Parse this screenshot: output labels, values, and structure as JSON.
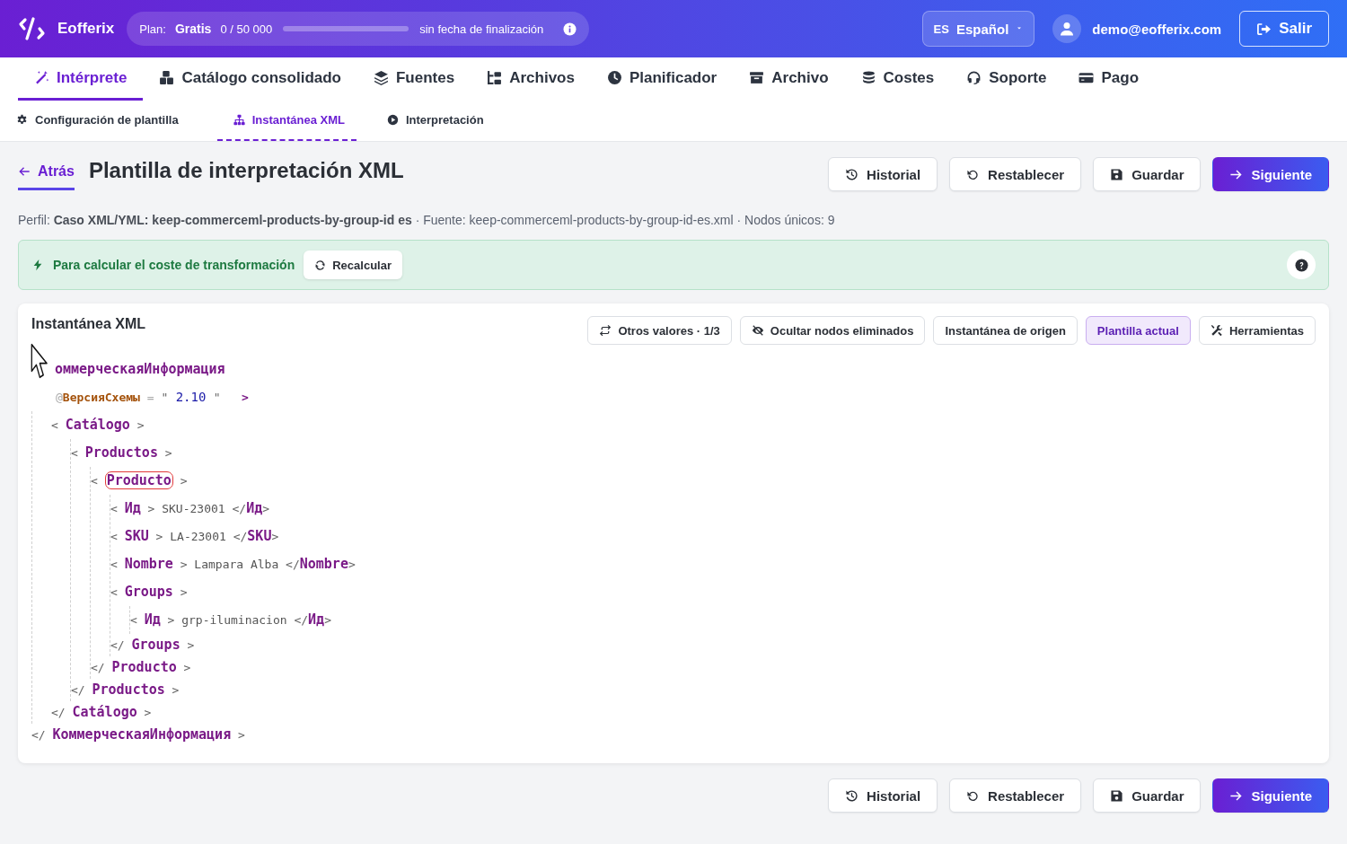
{
  "header": {
    "brand": "Eofferix",
    "plan": {
      "label": "Plan:",
      "name": "Gratis",
      "usage": "0 / 50 000",
      "level": 0,
      "expiry": "sin fecha de finalización"
    },
    "language": {
      "code": "ES",
      "name": "Español"
    },
    "user": {
      "email": "demo@eofferix.com"
    },
    "logout": "Salir"
  },
  "nav_tabs": [
    {
      "label": "Intérprete",
      "selected": true
    },
    {
      "label": "Catálogo consolidado",
      "selected": false
    },
    {
      "label": "Fuentes",
      "selected": false
    },
    {
      "label": "Archivos",
      "selected": false
    },
    {
      "label": "Planificador",
      "selected": false
    },
    {
      "label": "Archivo",
      "selected": false
    },
    {
      "label": "Costes",
      "selected": false
    },
    {
      "label": "Soporte",
      "selected": false
    },
    {
      "label": "Pago",
      "selected": false
    }
  ],
  "sub_tabs": [
    {
      "label": "Configuración de plantilla",
      "selected": false
    },
    {
      "label": "Instantánea XML",
      "selected": true
    },
    {
      "label": "Interpretación",
      "selected": false
    }
  ],
  "page": {
    "back": "Atrás",
    "title": "Plantilla de interpretación XML",
    "actions": [
      {
        "label": "Historial",
        "kind": "default"
      },
      {
        "label": "Restablecer",
        "kind": "default"
      },
      {
        "label": "Guardar",
        "kind": "default"
      },
      {
        "label": "Siguiente",
        "kind": "primary"
      }
    ],
    "info": "Perfil: **Caso XML/YML: keep-commerceml-products-by-group-id es** · Fuente: keep-commerceml-products-by-group-id-es.xml · Nodos únicos: 9"
  },
  "alert": {
    "text": "Para calcular el coste de transformación",
    "button": "Recalcular"
  },
  "snapshot": {
    "title": "Instantánea XML",
    "toggles": [
      {
        "label": "Otros valores · 1/3",
        "selected": false
      },
      {
        "label": "Ocultar nodos eliminados",
        "selected": false
      },
      {
        "label": "Instantánea de origen",
        "selected": false
      },
      {
        "label": "Plantilla actual",
        "selected": true
      },
      {
        "label": "Herramientas",
        "selected": false
      }
    ],
    "tree": {
      "open": [
        {
          "kind": "tag",
          "text": "оммерческаяИнформация"
        }
      ],
      "attributes": [
        {
          "kind": "at",
          "text": "@"
        },
        {
          "kind": "attr",
          "text": "ВерсияСхемы"
        },
        {
          "kind": "at",
          "text": " = "
        },
        {
          "kind": "punct",
          "text": "\""
        },
        {
          "kind": "value",
          "text": " 2.10 "
        },
        {
          "kind": "punct",
          "text": "\""
        },
        {
          "kind": "close",
          "text": "   >"
        }
      ],
      "children": [
        {
          "open": [
            {
              "kind": "punct",
              "text": "<"
            },
            {
              "kind": "tag",
              "text": "Catálogo"
            },
            {
              "kind": "punct",
              "text": ">"
            }
          ],
          "children": [
            {
              "open": [
                {
                  "kind": "punct",
                  "text": "<"
                },
                {
                  "kind": "tag",
                  "text": "Productos"
                },
                {
                  "kind": "punct",
                  "text": ">"
                }
              ],
              "children": [
                {
                  "open": [
                    {
                      "kind": "punct",
                      "text": "<"
                    },
                    {
                      "kind": "tag",
                      "text": "Producto",
                      "highlighted": true
                    },
                    {
                      "kind": "punct",
                      "text": ">"
                    }
                  ],
                  "children": [
                    {
                      "line": [
                        {
                          "kind": "punct",
                          "text": "<"
                        },
                        {
                          "kind": "tag",
                          "text": "Ид"
                        },
                        {
                          "kind": "punct",
                          "text": ">"
                        },
                        {
                          "kind": "text",
                          "text": "SKU-23001"
                        },
                        {
                          "kind": "punct",
                          "text": "</"
                        },
                        {
                          "kind": "tagc",
                          "text": "Ид"
                        },
                        {
                          "kind": "punct",
                          "text": ">"
                        }
                      ]
                    },
                    {
                      "line": [
                        {
                          "kind": "punct",
                          "text": "<"
                        },
                        {
                          "kind": "tag",
                          "text": "SKU"
                        },
                        {
                          "kind": "punct",
                          "text": ">"
                        },
                        {
                          "kind": "text",
                          "text": "LA-23001"
                        },
                        {
                          "kind": "punct",
                          "text": "</"
                        },
                        {
                          "kind": "tagc",
                          "text": "SKU"
                        },
                        {
                          "kind": "punct",
                          "text": ">"
                        }
                      ]
                    },
                    {
                      "line": [
                        {
                          "kind": "punct",
                          "text": "<"
                        },
                        {
                          "kind": "tag",
                          "text": "Nombre"
                        },
                        {
                          "kind": "punct",
                          "text": ">"
                        },
                        {
                          "kind": "text",
                          "text": "Lampara Alba"
                        },
                        {
                          "kind": "punct",
                          "text": "</"
                        },
                        {
                          "kind": "tagc",
                          "text": "Nombre"
                        },
                        {
                          "kind": "punct",
                          "text": ">"
                        }
                      ]
                    },
                    {
                      "open": [
                        {
                          "kind": "punct",
                          "text": "<"
                        },
                        {
                          "kind": "tag",
                          "text": "Groups"
                        },
                        {
                          "kind": "punct",
                          "text": ">"
                        }
                      ],
                      "children": [
                        {
                          "line": [
                            {
                              "kind": "punct",
                              "text": "<"
                            },
                            {
                              "kind": "tag",
                              "text": "Ид"
                            },
                            {
                              "kind": "punct",
                              "text": ">"
                            },
                            {
                              "kind": "text",
                              "text": "grp-iluminacion"
                            },
                            {
                              "kind": "punct",
                              "text": "</"
                            },
                            {
                              "kind": "tagc",
                              "text": "Ид"
                            },
                            {
                              "kind": "punct",
                              "text": ">"
                            }
                          ]
                        }
                      ],
                      "close": [
                        {
                          "kind": "punct",
                          "text": "</"
                        },
                        {
                          "kind": "tag",
                          "text": "Groups"
                        },
                        {
                          "kind": "punct",
                          "text": ">"
                        }
                      ]
                    }
                  ],
                  "close": [
                    {
                      "kind": "punct",
                      "text": "</"
                    },
                    {
                      "kind": "tag",
                      "text": "Producto"
                    },
                    {
                      "kind": "punct",
                      "text": ">"
                    }
                  ]
                }
              ],
              "close": [
                {
                  "kind": "punct",
                  "text": "</"
                },
                {
                  "kind": "tag",
                  "text": "Productos"
                },
                {
                  "kind": "punct",
                  "text": ">"
                }
              ]
            }
          ],
          "close": [
            {
              "kind": "punct",
              "text": "</"
            },
            {
              "kind": "tag",
              "text": "Catálogo"
            },
            {
              "kind": "punct",
              "text": ">"
            }
          ]
        }
      ],
      "close": [
        {
          "kind": "punct",
          "text": "</"
        },
        {
          "kind": "tag",
          "text": "КоммерческаяИнформация"
        },
        {
          "kind": "punct",
          "text": ">"
        }
      ]
    }
  },
  "bottom_actions": [
    {
      "label": "Historial",
      "kind": "default"
    },
    {
      "label": "Restablecer",
      "kind": "default"
    },
    {
      "label": "Guardar",
      "kind": "default"
    },
    {
      "label": "Siguiente",
      "kind": "primary"
    }
  ]
}
